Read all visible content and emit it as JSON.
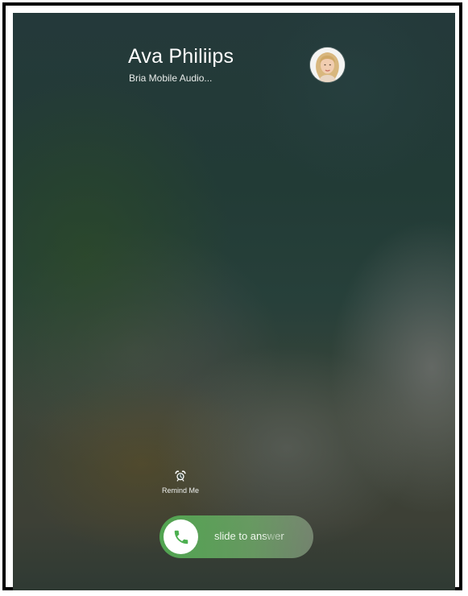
{
  "call": {
    "caller_name": "Ava Philiips",
    "app_name": "Bria Mobile Audio..."
  },
  "actions": {
    "remind_label": "Remind Me",
    "remind_icon": "alarm-clock-icon"
  },
  "slider": {
    "label": "slide to answer",
    "icon": "phone-icon",
    "accent": "#4caf50"
  }
}
